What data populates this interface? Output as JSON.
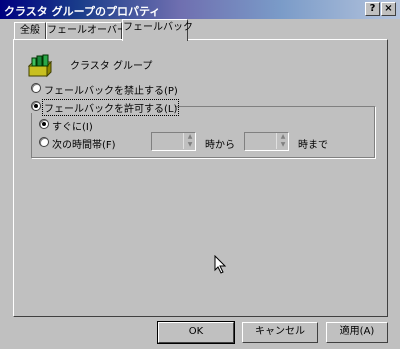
{
  "window": {
    "title": "クラスタ グループのプロパティ"
  },
  "caption_buttons": {
    "help": "?",
    "close": "×"
  },
  "tabs": [
    {
      "label": "全般"
    },
    {
      "label": "フェールオーバー"
    },
    {
      "label": "フェールバック"
    }
  ],
  "group": {
    "name": "クラスタ グループ"
  },
  "failback": {
    "prevent_label": "フェールバックを禁止する(P)",
    "allow_label": "フェールバックを許可する(L)",
    "selected": "allow",
    "immediately_label": "すぐに(I)",
    "between_hours_label": "次の時間帯(F)",
    "sub_selected": "immediately",
    "from_value": "",
    "from_label": "時から",
    "to_value": "",
    "to_label": "時まで"
  },
  "buttons": {
    "ok": "OK",
    "cancel": "キャンセル",
    "apply": "適用(A)"
  },
  "icons": [
    "cluster-group-icon",
    "mouse-cursor-icon"
  ]
}
